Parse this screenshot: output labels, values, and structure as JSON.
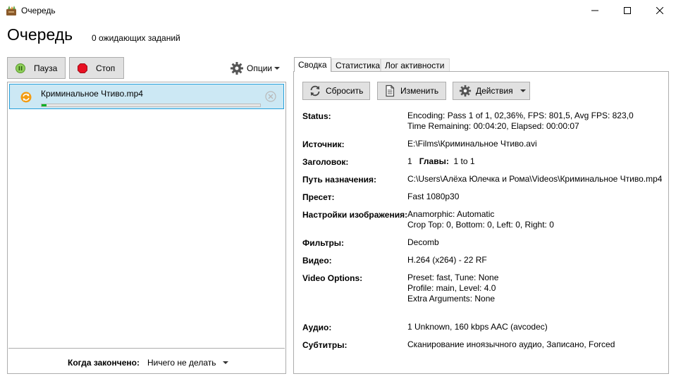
{
  "window": {
    "title": "Очередь",
    "app_icon": "handbrake-icon",
    "controls": [
      "minimize-icon",
      "maximize-icon",
      "close-icon"
    ]
  },
  "header": {
    "title": "Очередь",
    "pending_text": "0 ожидающих заданий"
  },
  "toolbar": {
    "pause_label": "Пауза",
    "stop_label": "Стоп",
    "options_label": "Опции"
  },
  "queue": {
    "items": [
      {
        "name": "Криминальное Чтиво.mp4",
        "status_icon": "encoding-icon",
        "progress_percent": 2.36
      }
    ],
    "footer": {
      "when_done_label": "Когда закончено:",
      "when_done_value": "Ничего не делать"
    }
  },
  "tabs": [
    {
      "label": "Сводка",
      "active": true
    },
    {
      "label": "Статистика",
      "active": false
    },
    {
      "label": "Лог активности",
      "active": false
    }
  ],
  "details_toolbar": {
    "reset_label": "Сбросить",
    "edit_label": "Изменить",
    "actions_label": "Действия"
  },
  "details": {
    "status": {
      "label": "Status:",
      "line1": "Encoding: Pass 1 of 1,  02,36%, FPS: 801,5,  Avg FPS: 823,0",
      "line2": "Time Remaining: 00:04:20,  Elapsed: 00:00:07"
    },
    "source": {
      "label": "Источник:",
      "value": "E:\\Films\\Криминальное Чтиво.avi"
    },
    "title": {
      "label": "Заголовок:",
      "value": "1",
      "chapters_label": "Главы:",
      "chapters_value": "1  to  1"
    },
    "destination": {
      "label": "Путь назначения:",
      "value": "C:\\Users\\Алёха Юлечка и Рома\\Videos\\Криминальное Чтиво.mp4"
    },
    "preset": {
      "label": "Пресет:",
      "value": "Fast 1080p30"
    },
    "picture": {
      "label": "Настройки изображения:",
      "line1": "Anamorphic: Automatic",
      "line2": "Crop Top: 0, Bottom: 0, Left: 0, Right: 0"
    },
    "filters": {
      "label": "Фильтры:",
      "value": "Decomb"
    },
    "video": {
      "label": "Видео:",
      "value": "H.264 (x264) - 22 RF"
    },
    "video_options": {
      "label": "Video Options:",
      "line1": "Preset: fast, Tune: None",
      "line2": "Profile: main, Level: 4.0",
      "line3": "Extra Arguments: None"
    },
    "audio": {
      "label": "Аудио:",
      "value": "1 Unknown, 160 kbps AAC (avcodec)"
    },
    "subtitles": {
      "label": "Субтитры:",
      "value": "Сканирование иноязычного аудио, Записано, Forced"
    }
  },
  "colors": {
    "selection_bg": "#cce8f4",
    "selection_border": "#26a0da",
    "progress": "#06b025",
    "stop_red": "#e81123",
    "pause_green": "#7bc043"
  }
}
